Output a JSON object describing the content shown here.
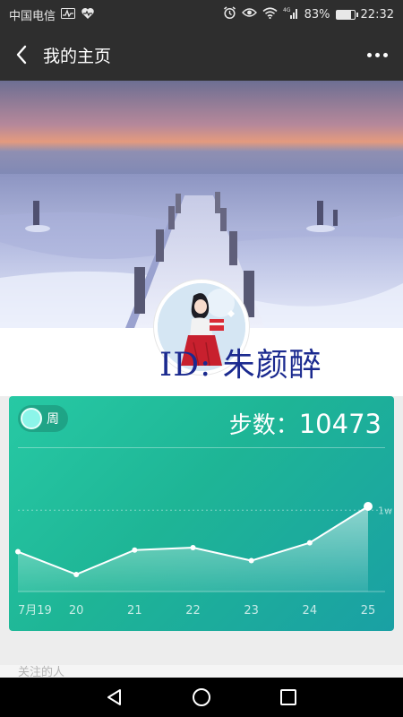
{
  "status_bar": {
    "carrier": "中国电信",
    "battery_percent": "83%",
    "battery_level": 0.83,
    "time": "22:32",
    "icons": [
      "activity-icon",
      "heart-rate-icon",
      "alarm-icon",
      "eye-icon",
      "wifi-icon",
      "signal-4g-icon",
      "battery-icon"
    ]
  },
  "header": {
    "title": "我的主页",
    "back_icon": "chevron-left-icon",
    "more_icon": "more-icon"
  },
  "profile": {
    "id_prefix": "ID:",
    "name": "朱颜醉",
    "cover": "snowy-pier-sunset-image",
    "avatar": "girl-red-skirt-avatar"
  },
  "steps_card": {
    "toggle_label": "周",
    "steps_label": "步数：",
    "steps_value": "10473",
    "colors": {
      "start": "#27c9a4",
      "end": "#1aa0a4",
      "line": "#ffffff"
    }
  },
  "chart_data": {
    "type": "area",
    "x": [
      "7月19",
      "20",
      "21",
      "22",
      "23",
      "24",
      "25"
    ],
    "values": [
      4900,
      2100,
      5100,
      5400,
      3800,
      6000,
      10473
    ],
    "reference_line_label": "1w",
    "reference_line_value": 10000,
    "ylim": [
      0,
      10473
    ],
    "grid": false
  },
  "sections": {
    "following_label": "关注的人"
  },
  "nav": {
    "back_icon": "triangle-back-icon",
    "home_icon": "circle-home-icon",
    "recents_icon": "square-recents-icon"
  }
}
